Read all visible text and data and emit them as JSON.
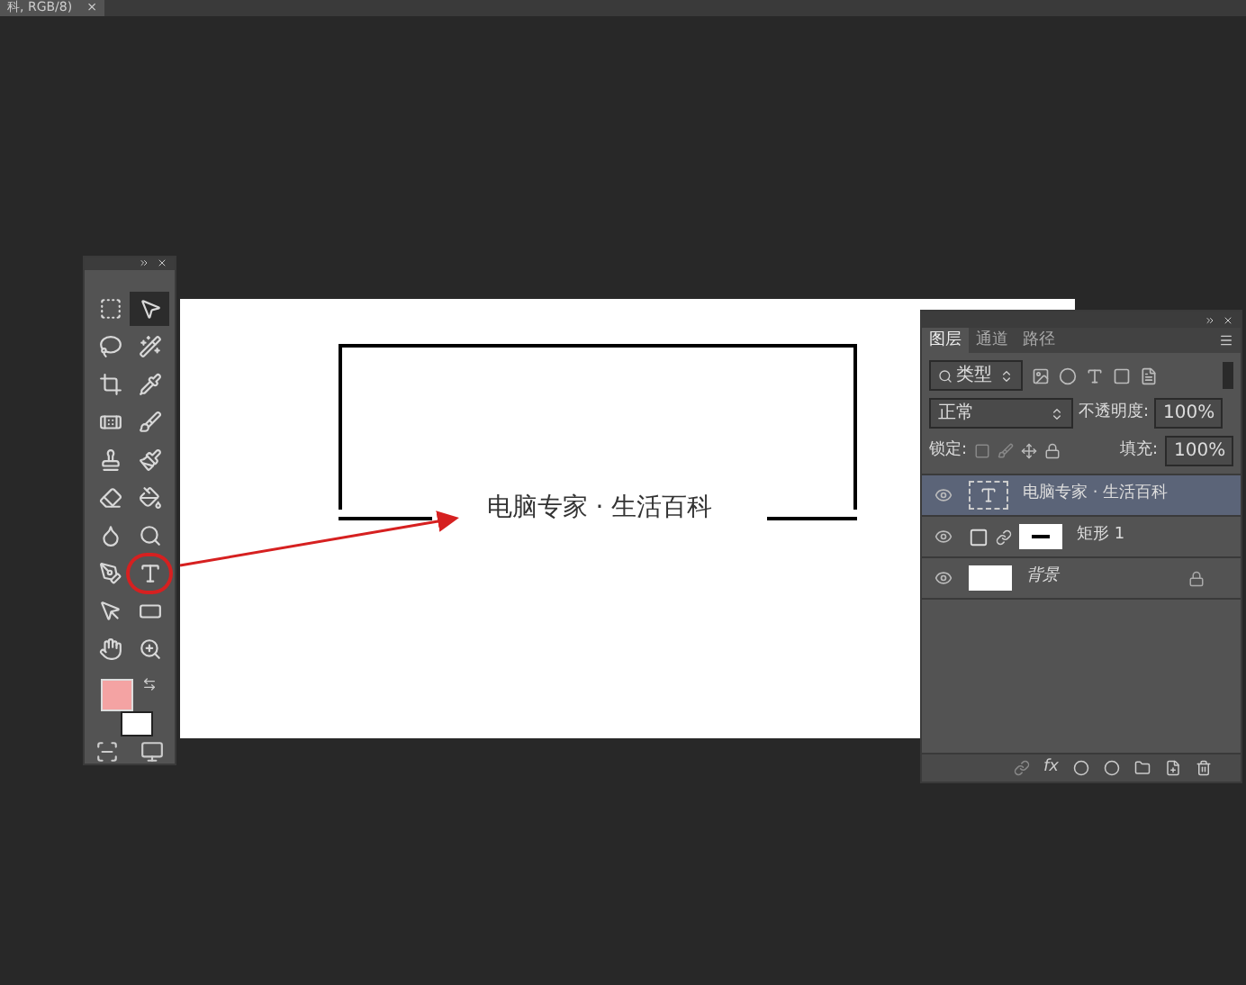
{
  "document_tab": {
    "title": "科, RGB/8)",
    "close": "×"
  },
  "toolbox": {
    "tools": [
      {
        "selected": false
      },
      {
        "selected": true
      },
      {
        "selected": false
      },
      {
        "selected": false
      },
      {
        "selected": false
      },
      {
        "selected": false
      },
      {
        "selected": false
      },
      {
        "selected": false
      },
      {
        "selected": false
      },
      {
        "selected": false
      },
      {
        "selected": false
      },
      {
        "selected": false
      },
      {
        "selected": false
      },
      {
        "selected": false
      },
      {
        "selected": false
      },
      {
        "selected": false,
        "highlighted": true
      },
      {
        "selected": false
      },
      {
        "selected": false
      },
      {
        "selected": false
      },
      {
        "selected": false
      }
    ]
  },
  "canvas": {
    "text": "电脑专家 · 生活百科"
  },
  "layers_panel": {
    "tabs": [
      {
        "label": "图层",
        "selected": true
      },
      {
        "label": "通道",
        "selected": false
      },
      {
        "label": "路径",
        "selected": false
      }
    ],
    "filter": "类型",
    "blend_mode": "正常",
    "opacity_label": "不透明度:",
    "opacity": "100%",
    "lock_label": "锁定:",
    "fill_label": "填充:",
    "fill": "100%",
    "fx_label": "fx",
    "layers": [
      {
        "kind": "text",
        "name": "电脑专家 · 生活百科",
        "selected": true,
        "visible": true,
        "locked": false
      },
      {
        "kind": "shape",
        "name": "矩形 1",
        "selected": false,
        "visible": true,
        "locked": false
      },
      {
        "kind": "background",
        "name": "背景",
        "selected": false,
        "visible": true,
        "locked": true
      }
    ]
  }
}
